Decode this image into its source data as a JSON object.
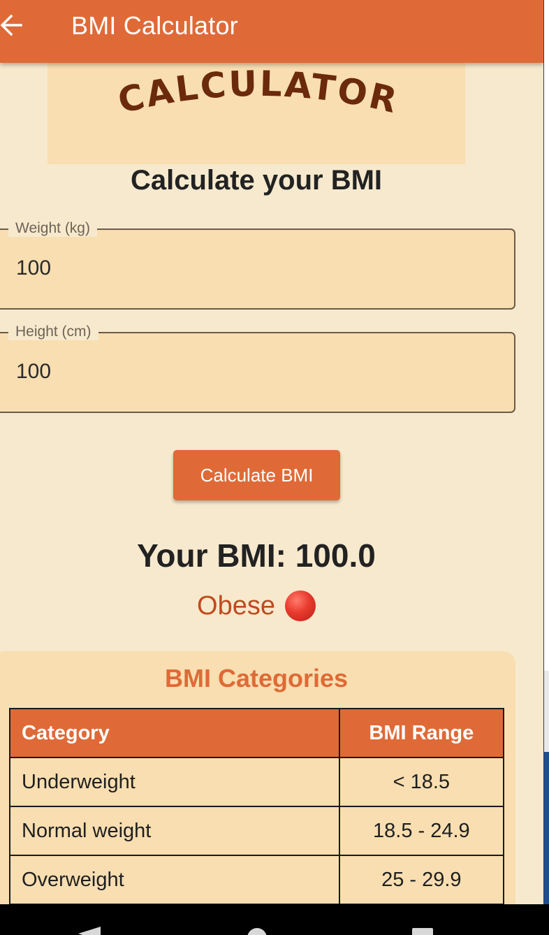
{
  "appbar": {
    "title": "BMI Calculator",
    "back_icon": "arrow-left-icon"
  },
  "banner": {
    "text": "CALCULATOR"
  },
  "heading": "Calculate your BMI",
  "form": {
    "weight": {
      "label": "Weight (kg)",
      "value": "100"
    },
    "height": {
      "label": "Height (cm)",
      "value": "100"
    }
  },
  "button": {
    "label": "Calculate BMI"
  },
  "result": {
    "text": "Your BMI: 100.0",
    "category": "Obese",
    "status_icon": "red-circle-icon"
  },
  "categories": {
    "title": "BMI Categories",
    "headers": [
      "Category",
      "BMI Range"
    ],
    "rows": [
      [
        "Underweight",
        "< 18.5"
      ],
      [
        "Normal weight",
        "18.5 - 24.9"
      ],
      [
        "Overweight",
        "25 - 29.9"
      ]
    ]
  },
  "nav": {
    "back_icon": "nav-back-icon",
    "home_icon": "nav-home-icon",
    "recents_icon": "nav-recents-icon"
  },
  "colors": {
    "primary": "#df6a37",
    "background": "#f7e9cd",
    "surface": "#f8deb0",
    "banner_text": "#6b2a0c",
    "obese": "#c04a1e"
  }
}
